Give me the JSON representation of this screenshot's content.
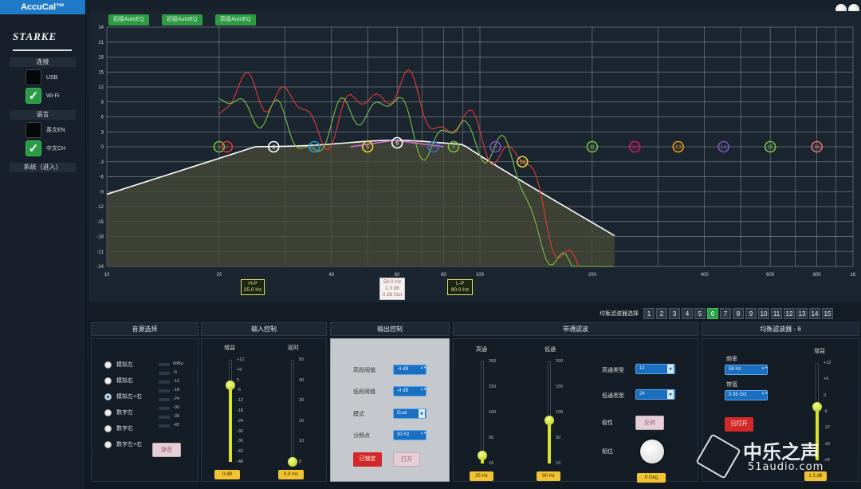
{
  "app": {
    "title": "AccuCal™",
    "logo_text": "STARKE"
  },
  "sidebar": {
    "connect_label": "连接",
    "usb_label": "USB",
    "wifi_label": "Wi-Fi",
    "language_label": "语言",
    "en_label": "英文EN",
    "ch_label": "中文CH",
    "system_label": "系统（进入）"
  },
  "autoeq": {
    "btn1": "初级AutoEQ",
    "btn2": "初级AutoEQ",
    "btn3": "高级AutoEQ"
  },
  "graph": {
    "y_ticks": [
      "24",
      "21",
      "18",
      "15",
      "12",
      "9",
      "6",
      "3",
      "0",
      "-3",
      "-6",
      "-9",
      "-12",
      "-15",
      "-18",
      "-21",
      "-24"
    ],
    "x_ticks": [
      "10",
      "20",
      "40",
      "60",
      "80",
      "100",
      "200",
      "400",
      "600",
      "800",
      "1K"
    ],
    "band_marker_labels": [
      "1",
      "2",
      "3",
      "4",
      "5",
      "6",
      "7",
      "8",
      "9",
      "10",
      "11",
      "12",
      "13",
      "14",
      "15",
      "16"
    ],
    "hp_marker": {
      "title": "H-P",
      "value": "25.0 Hz"
    },
    "lp_marker": {
      "title": "L-P",
      "value": "90.0 Hz"
    },
    "sel_marker": {
      "line1": "59.0 Hz",
      "line2": "1.3 db",
      "line3": "0.36 Oct"
    }
  },
  "colors": {
    "accent": "#2d9e47",
    "red_curve": "#e53935",
    "green_curve": "#7bc043",
    "white_curve": "#ffffff",
    "eq_curve": "#d86bd8"
  },
  "band_selector": {
    "label": "均衡滤波器选择",
    "buttons": [
      "1",
      "2",
      "3",
      "4",
      "5",
      "6",
      "7",
      "8",
      "9",
      "10",
      "11",
      "12",
      "13",
      "14",
      "15"
    ],
    "active": "6"
  },
  "source": {
    "title": "音源选择",
    "options": [
      "模拟左",
      "模拟右",
      "模拟左+右",
      "数字左",
      "数字右",
      "数字左+右"
    ],
    "selected": "模拟左+右",
    "meter_labels": [
      "0dBu",
      "-6",
      "-12",
      "-18",
      "-24",
      "-30",
      "-36",
      "-42"
    ],
    "mute_label": "静音"
  },
  "input": {
    "title": "输入控制",
    "gain_label": "增益",
    "delay_label": "延时",
    "gain_ticks": [
      "+12",
      "+6",
      "0",
      "-6",
      "-12",
      "-18",
      "-24",
      "-30",
      "-36",
      "-42",
      "-48"
    ],
    "delay_ticks": [
      "50",
      "40",
      "30",
      "20",
      "10",
      "0"
    ],
    "gain_value": "0 dB",
    "delay_value": "0.0 ms",
    "gain_level": 0.75,
    "delay_level": 0.0
  },
  "output": {
    "title": "输出控制",
    "high_threshold_label": "高段阈值",
    "high_threshold_value": "-4 dB",
    "low_threshold_label": "低段阈值",
    "low_threshold_value": "-4 dB",
    "mode_label": "模式",
    "mode_value": "Dual",
    "crossover_label": "分频点",
    "crossover_value": "30 Hz",
    "locked_label": "已锁定",
    "open_label": "打开"
  },
  "bandpass": {
    "title": "带通滤波",
    "hp_label": "高通",
    "lp_label": "低通",
    "hp_ticks": [
      "200",
      "150",
      "100",
      "50",
      "10"
    ],
    "lp_ticks": [
      "200",
      "150",
      "100",
      "50",
      "10"
    ],
    "hp_value": "25 Hz",
    "lp_value": "90 Hz",
    "hp_level": 0.08,
    "lp_level": 0.42,
    "hp_type_label": "高通类型",
    "hp_type_value": "12",
    "lp_type_label": "低通类型",
    "lp_type_value": "24",
    "polarity_label": "极性",
    "polarity_btn": "反转",
    "phase_label": "相位",
    "phase_value": "0 Deg"
  },
  "eqfilter": {
    "title": "均衡滤波器 - 6",
    "freq_label": "频率",
    "freq_value": "59 Hz",
    "bw_label": "带宽",
    "bw_value": "0.36 Oct",
    "gain_label": "增益",
    "enabled_label": "已打开",
    "gain_ticks": [
      "+12",
      "+6",
      "0",
      "-6",
      "-12",
      "-18",
      "-24"
    ],
    "gain_value": "1.3 dB",
    "gain_level": 0.55
  },
  "watermark": {
    "cn": "中乐之声",
    "url": "51audio.com"
  }
}
